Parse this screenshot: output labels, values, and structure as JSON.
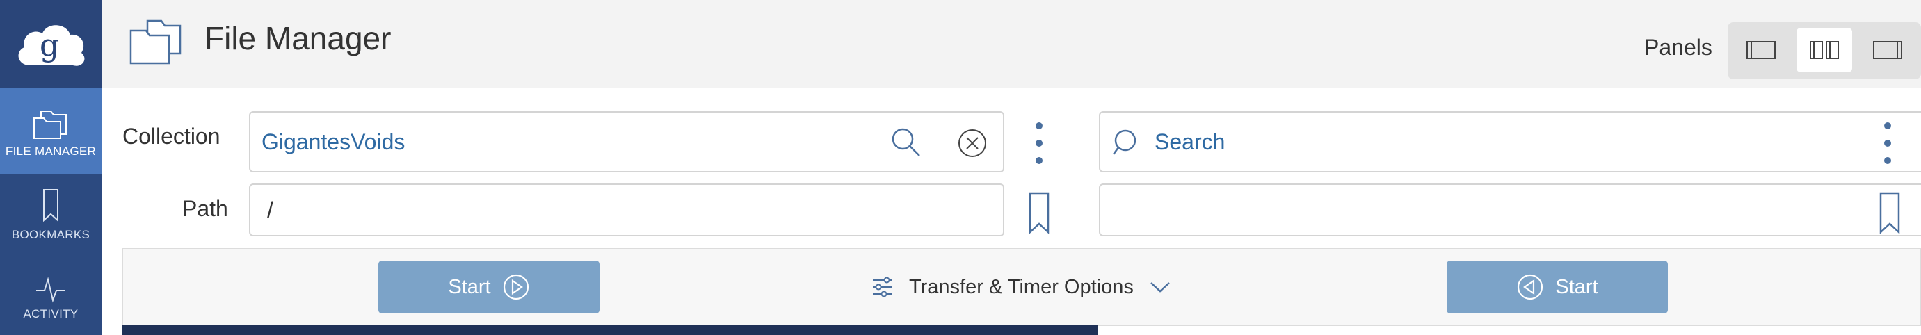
{
  "sidebar": {
    "logo_icon": "globus-cloud-logo",
    "items": [
      {
        "label": "FILE MANAGER",
        "icon": "folders-icon",
        "active": true
      },
      {
        "label": "BOOKMARKS",
        "icon": "bookmark-icon",
        "active": false
      },
      {
        "label": "ACTIVITY",
        "icon": "pulse-icon",
        "active": false
      }
    ]
  },
  "header": {
    "title": "File Manager",
    "panels_label": "Panels",
    "panel_options": [
      "single-left",
      "two-panel",
      "single-right"
    ],
    "selected_panel": "two-panel"
  },
  "left_panel": {
    "collection_label": "Collection",
    "collection_value": "GigantesVoids",
    "path_label": "Path",
    "path_value": "/"
  },
  "right_panel": {
    "collection_placeholder": "Search",
    "path_value": ""
  },
  "transfer": {
    "start_left_label": "Start",
    "options_label": "Transfer & Timer Options",
    "start_right_label": "Start"
  },
  "colors": {
    "sidebar_bg": "#2c4a80",
    "active_nav": "#4a78bd",
    "link_blue": "#2f6aa3",
    "start_button": "#7ca3c8"
  }
}
